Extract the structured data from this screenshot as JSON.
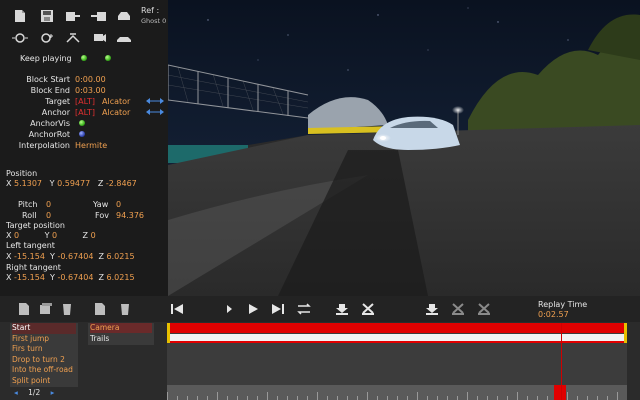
{
  "ref": {
    "label": "Ref :",
    "ghost": "Ghost 0"
  },
  "keep_playing": "Keep playing",
  "props": {
    "block_start": {
      "label": "Block Start",
      "value": "0:00.00"
    },
    "block_end": {
      "label": "Block End",
      "value": "0:03.00"
    },
    "target": {
      "label": "Target",
      "tag": "[ALT]",
      "value": "Alcator"
    },
    "anchor": {
      "label": "Anchor",
      "tag": "[ALT]",
      "value": "Alcator"
    },
    "anchor_vis": {
      "label": "AnchorVis"
    },
    "anchor_rot": {
      "label": "AnchorRot"
    },
    "interpolation": {
      "label": "Interpolation",
      "value": "Hermite"
    }
  },
  "position": {
    "title": "Position",
    "x_label": "X",
    "x": "5.1307",
    "y_label": "Y",
    "y": "0.59477",
    "z_label": "Z",
    "z": "-2.8467"
  },
  "pitch": {
    "label": "Pitch",
    "value": "0"
  },
  "yaw": {
    "label": "Yaw",
    "value": "0"
  },
  "roll": {
    "label": "Roll",
    "value": "0"
  },
  "fov": {
    "label": "Fov",
    "value": "94.376"
  },
  "target_position": {
    "title": "Target position",
    "x": "0",
    "y": "0",
    "z": "0"
  },
  "left_tangent": {
    "title": "Left tangent",
    "x": "-15.154",
    "y": "-0.67404",
    "z": "6.0215"
  },
  "right_tangent": {
    "title": "Right tangent",
    "x": "-15.154",
    "y": "-0.67404",
    "z": "6.0215"
  },
  "replay": {
    "label": "Replay Time",
    "value": "0:02.57"
  },
  "blocks": [
    "Start",
    "First jump",
    "Firs turn",
    "Drop to turn 2",
    "Into the off-road",
    "Split point"
  ],
  "tracks": [
    "Camera",
    "Trails"
  ],
  "pager": {
    "prev": "◂",
    "page": "1/2",
    "next": "▸"
  },
  "colors": {
    "accent": "#f0a050",
    "timeline_red": "#e00000",
    "edge": "#e8c000"
  },
  "timeline": {
    "playhead_fraction": 0.857
  }
}
